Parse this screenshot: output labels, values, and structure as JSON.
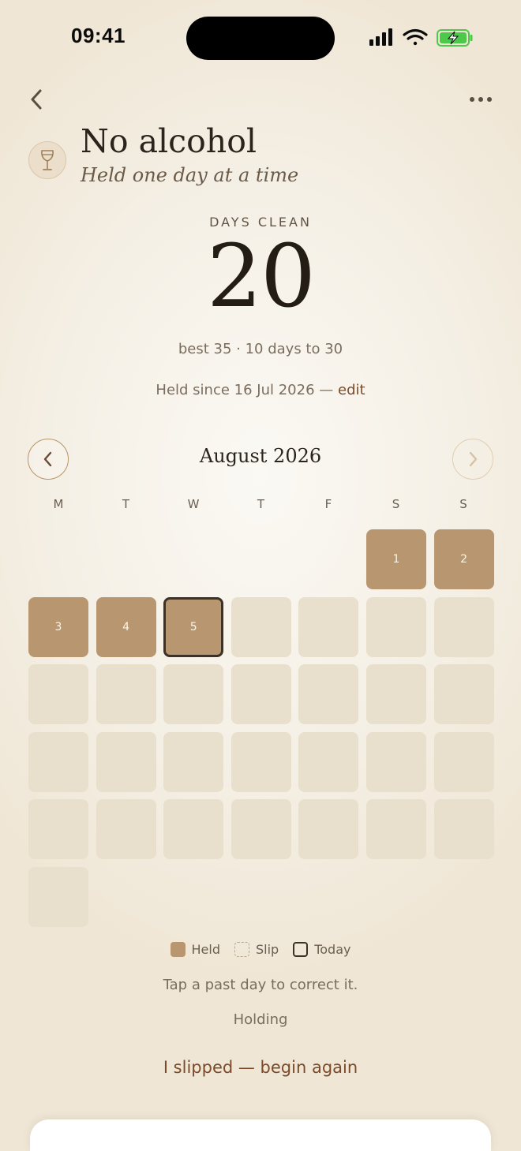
{
  "status_bar": {
    "time": "09:41"
  },
  "nav": {
    "back_icon": "chevron-left-icon",
    "more_icon": "more-horizontal-icon"
  },
  "habit": {
    "icon": "wine-glass-icon",
    "title": "No alcohol",
    "subtitle": "Held one day at a time"
  },
  "counter": {
    "label": "DAYS CLEAN",
    "value": "20",
    "best_text": "best 35 · 10 days to 30",
    "since_text": "Held since 16 Jul 2026 —",
    "edit_label": "edit"
  },
  "calendar": {
    "month_label": "August 2026",
    "weekdays": [
      "M",
      "T",
      "W",
      "T",
      "F",
      "S",
      "S"
    ],
    "leading_blanks": 5,
    "days_in_month": 31,
    "held_days": [
      1,
      2,
      3,
      4,
      5
    ],
    "today": 5,
    "colors": {
      "held": "#b8966f",
      "future": "#e9dfcd",
      "today_border": "#3c3127"
    }
  },
  "legend": {
    "held_label": "Held",
    "slip_label": "Slip",
    "today_label": "Today"
  },
  "footer": {
    "hint": "Tap a past day to correct it.",
    "status": "Holding",
    "slip_button": "I slipped — begin again"
  },
  "colors": {
    "accent": "#7b4a2a",
    "text": "#2b241c",
    "muted": "#7a6d5e"
  }
}
